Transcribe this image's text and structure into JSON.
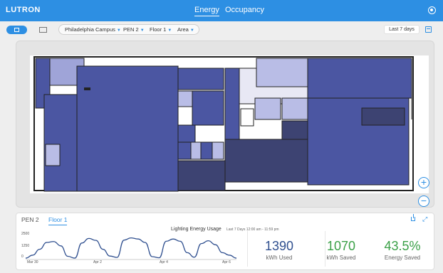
{
  "app": {
    "logo": "LUTRON"
  },
  "nav": {
    "energy": "Energy",
    "occupancy": "Occupancy"
  },
  "filters": {
    "campus": "Philadelphia Campus",
    "building": "PEN 2",
    "floor": "Floor 1",
    "area": "Area"
  },
  "date_range": "Last 7 days",
  "panel": {
    "tabs": [
      "PEN 2",
      "Floor 1"
    ],
    "active_tab": "Floor 1"
  },
  "chart_data": {
    "type": "line",
    "title": "Lighting Energy Usage",
    "subtitle": "Last 7 Days  12:00 am - 11:59 pm",
    "xlabel": "",
    "ylabel": "",
    "ylim": [
      0,
      2500
    ],
    "yticks": [
      "2500",
      "1250",
      "0"
    ],
    "xticks": [
      "Mar 30",
      "Apr 2",
      "Apr 4",
      "Apr 6"
    ],
    "series": [
      {
        "name": "",
        "values": [
          120,
          380,
          900,
          1500,
          1580,
          1200,
          280,
          120,
          1450,
          1850,
          1680,
          900,
          300,
          180,
          1700,
          1900,
          1800,
          1500,
          250,
          150,
          1600,
          1800,
          1600,
          600,
          200,
          1400,
          1650,
          1300,
          600,
          380,
          120
        ]
      }
    ]
  },
  "stats": [
    {
      "value": "1390",
      "label": "kWh Used",
      "color": "#2f4f8f"
    },
    {
      "value": "1070",
      "label": "kWh Saved",
      "color": "#3aa047"
    },
    {
      "value": "43.5%",
      "label": "Energy Saved",
      "color": "#3aa047"
    }
  ],
  "colors": {
    "accent": "#2d8fe3",
    "room": "#4b56a2",
    "room_light": "#b9bde6",
    "room_dark": "#3d4372"
  }
}
